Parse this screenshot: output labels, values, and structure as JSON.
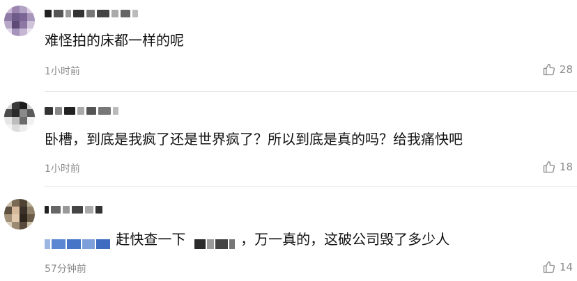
{
  "comments": [
    {
      "text": "难怪拍的床都一样的呢",
      "time": "1小时前",
      "likes": "28",
      "like_icon": "thumbs-up-icon"
    },
    {
      "text": "卧槽，到底是我疯了还是世界疯了？所以到底是真的吗？给我痛快吧",
      "time": "1小时前",
      "likes": "18",
      "like_icon": "thumbs-up-icon"
    },
    {
      "text_part1": "赶快查一下",
      "text_part2": "，万一真的，这破公司毁了多少人",
      "time": "57分钟前",
      "likes": "14",
      "like_icon": "thumbs-up-icon"
    }
  ],
  "colors": {
    "meta_text": "#8a8a8a",
    "mention": "#4a7bd0",
    "divider": "#e6e6e6"
  }
}
